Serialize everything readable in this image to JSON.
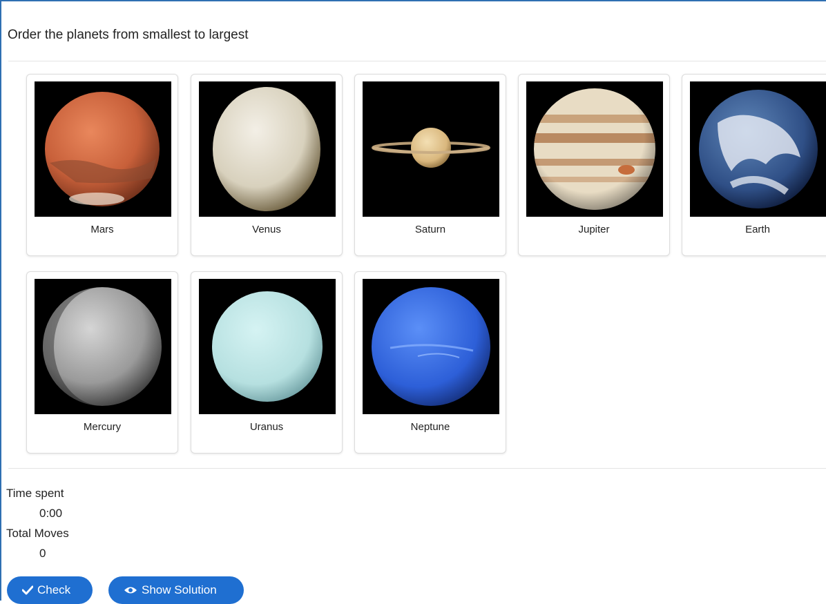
{
  "task": {
    "title": "Order the planets from smallest to largest"
  },
  "cards": [
    {
      "label": "Mars",
      "icon": "mars-image"
    },
    {
      "label": "Venus",
      "icon": "venus-image"
    },
    {
      "label": "Saturn",
      "icon": "saturn-image"
    },
    {
      "label": "Jupiter",
      "icon": "jupiter-image"
    },
    {
      "label": "Earth",
      "icon": "earth-image"
    },
    {
      "label": "Mercury",
      "icon": "mercury-image"
    },
    {
      "label": "Uranus",
      "icon": "uranus-image"
    },
    {
      "label": "Neptune",
      "icon": "neptune-image"
    }
  ],
  "stats": {
    "time_label": "Time spent",
    "time_value": "0:00",
    "moves_label": "Total Moves",
    "moves_value": "0"
  },
  "buttons": {
    "check": {
      "label": "Check",
      "icon": "checkmark-icon"
    },
    "solution": {
      "label": "Show Solution",
      "icon": "eye-icon"
    }
  },
  "colors": {
    "accent": "#1f6fd1",
    "frame": "#2f6fb2"
  }
}
